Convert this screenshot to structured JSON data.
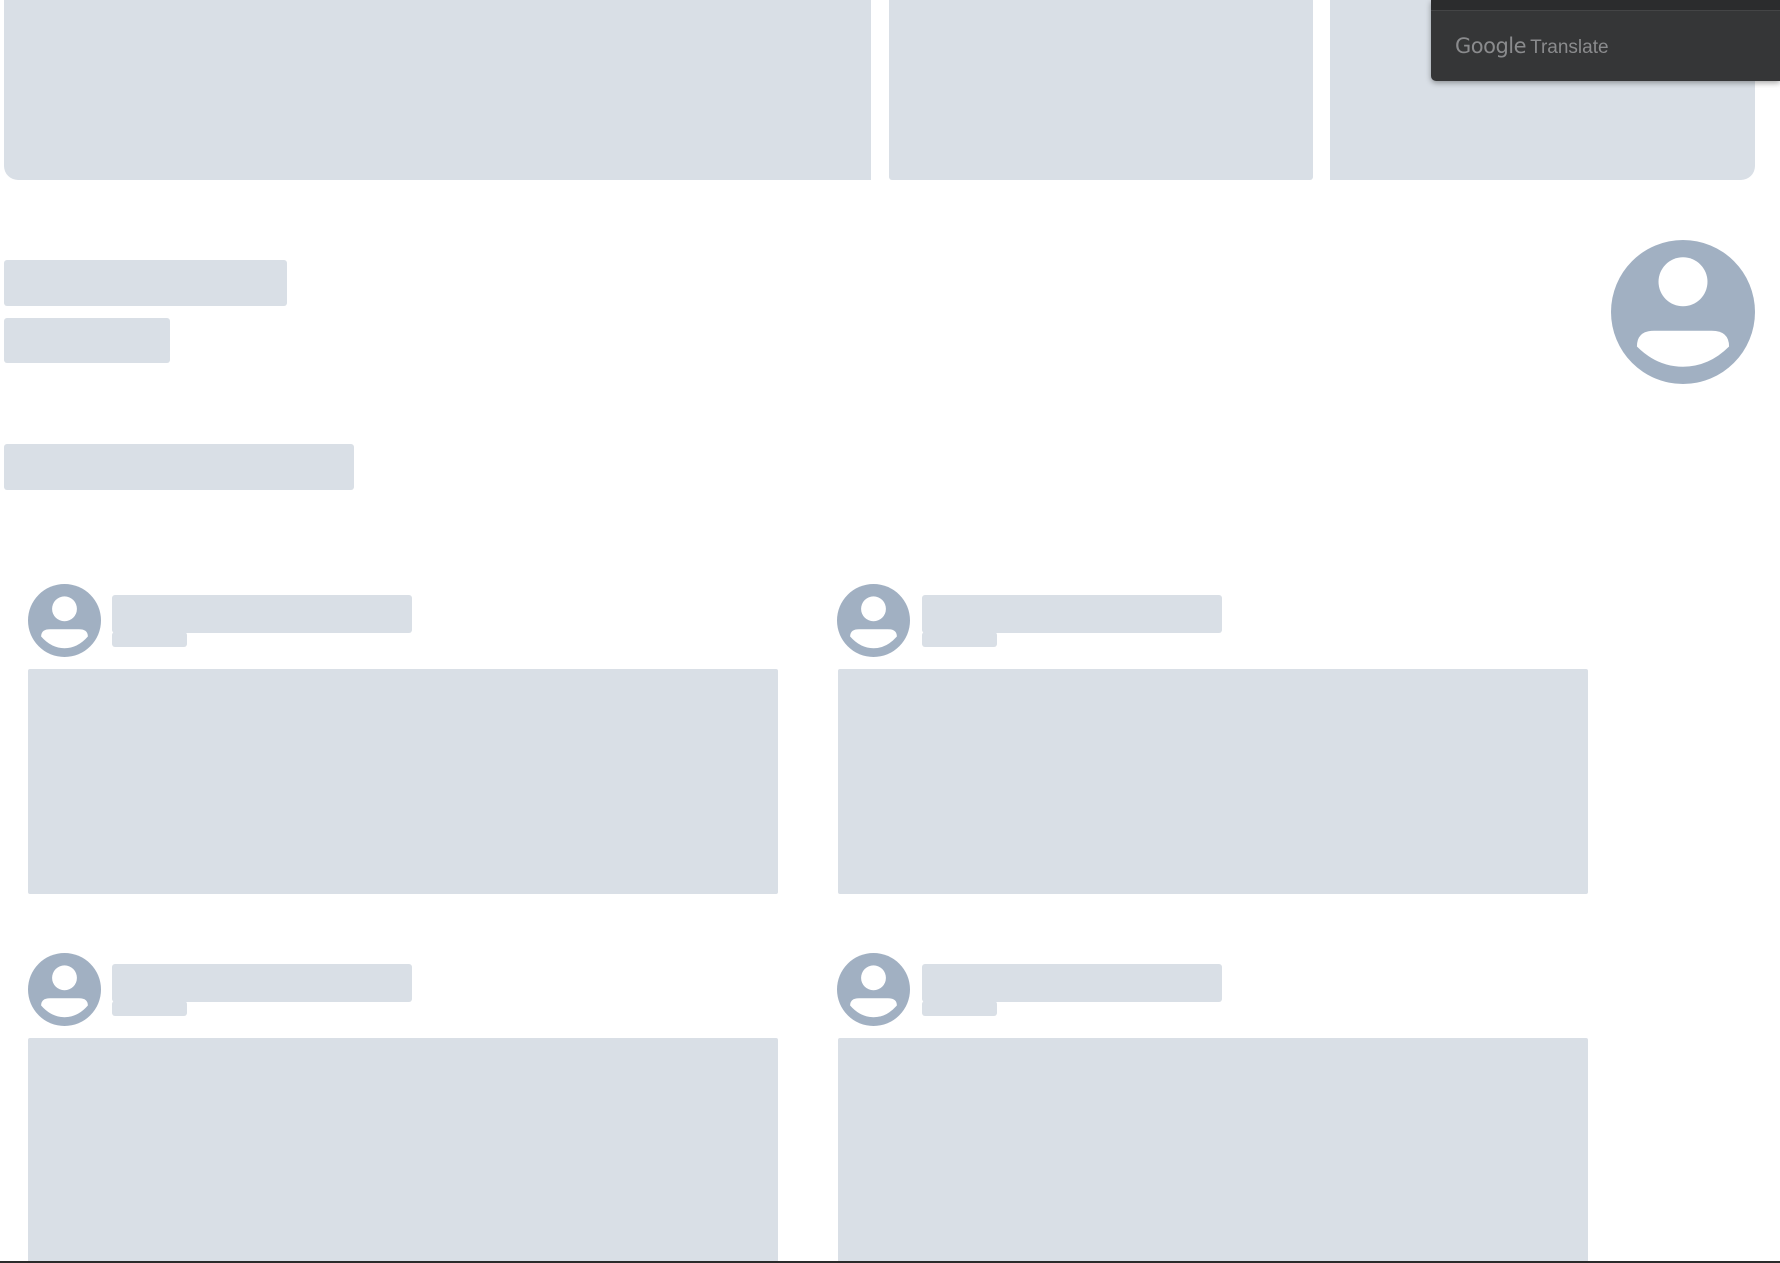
{
  "theme": {
    "skeleton_color": "#d9dfe6",
    "avatar_color": "#a1b0c2",
    "avatar_glyph_color": "#ffffff",
    "popup_background": "#353637",
    "popup_text_color": "#8a8b8d"
  },
  "state": "loading-skeleton",
  "profile": {
    "avatar_icon": "user-avatar-icon"
  },
  "posts": [
    {
      "avatar_icon": "user-avatar-icon"
    },
    {
      "avatar_icon": "user-avatar-icon"
    },
    {
      "avatar_icon": "user-avatar-icon"
    },
    {
      "avatar_icon": "user-avatar-icon"
    }
  ],
  "translate_popup": {
    "brand_google": "Google",
    "brand_translate": "Translate"
  }
}
